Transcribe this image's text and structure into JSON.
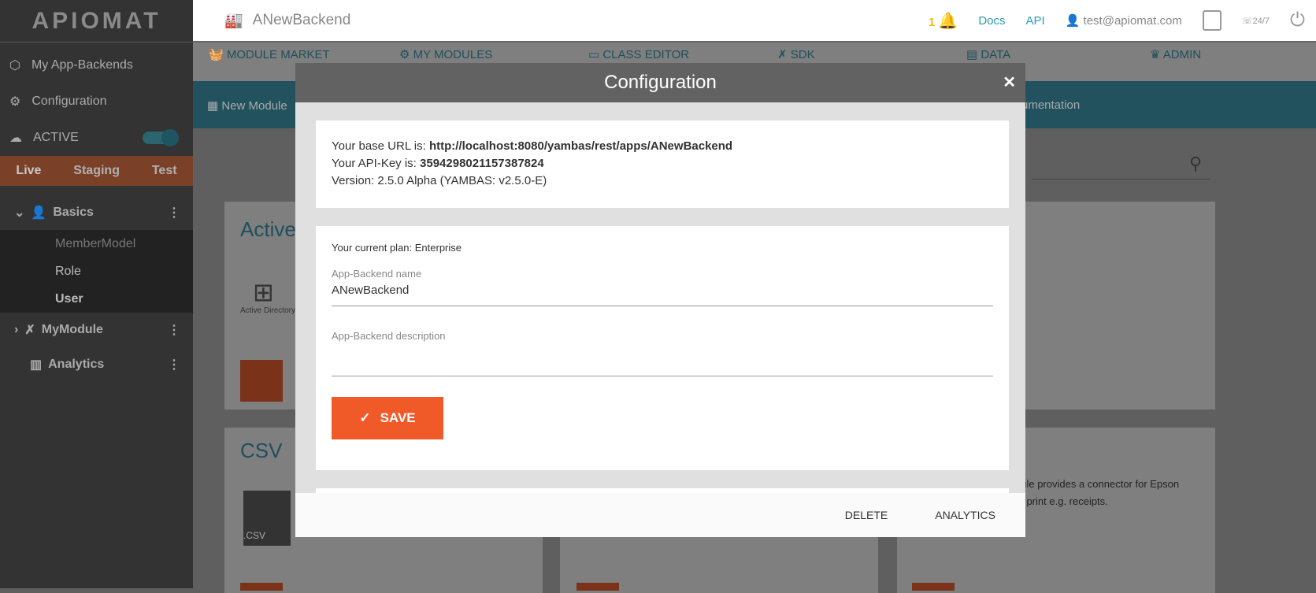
{
  "sidebar": {
    "logo": "APIOMAT",
    "items": [
      {
        "label": "My App-Backends",
        "icon": "cube-icon"
      },
      {
        "label": "Configuration",
        "icon": "gears-icon"
      },
      {
        "label": "ACTIVE",
        "icon": "cloud-icon"
      }
    ],
    "env_tabs": [
      "Live",
      "Staging",
      "Test"
    ],
    "groups": [
      {
        "label": "Basics",
        "children": [
          "MemberModel",
          "Role",
          "User"
        ]
      },
      {
        "label": "MyModule"
      },
      {
        "label": "Analytics"
      }
    ]
  },
  "header": {
    "title": "ANewBackend",
    "notifications": "1",
    "docs": "Docs",
    "api": "API",
    "user": "test@apiomat.com",
    "support": "24/7"
  },
  "nav": {
    "tabs": [
      "MODULE MARKET",
      "MY MODULES",
      "CLASS EDITOR",
      "SDK",
      "DATA",
      "ADMIN"
    ],
    "sub_left": "New Module",
    "sub_right": "umentation"
  },
  "background": {
    "card1_title": "Activel",
    "card1_icon_label": "Active Directory",
    "card2_title": "CSV",
    "card3_text1": "dule provides a connector for Epson",
    "card3_text2": "to print e.g. receipts."
  },
  "modal": {
    "title": "Configuration",
    "base_url_label": "Your base URL is: ",
    "base_url": "http://localhost:8080/yambas/rest/apps/ANewBackend",
    "api_key_label": "Your API-Key is: ",
    "api_key": "3594298021157387824",
    "version": "Version: 2.5.0 Alpha (YAMBAS: v2.5.0-E)",
    "plan": "Your current plan: Enterprise",
    "name_label": "App-Backend name",
    "name_value": "ANewBackend",
    "desc_label": "App-Backend description",
    "desc_value": "",
    "save": "SAVE",
    "delete": "DELETE",
    "analytics": "ANALYTICS"
  },
  "colors": {
    "accent": "#f05a28",
    "teal": "#22525d",
    "link": "#2a9bb0",
    "bell": "#f5b800"
  }
}
